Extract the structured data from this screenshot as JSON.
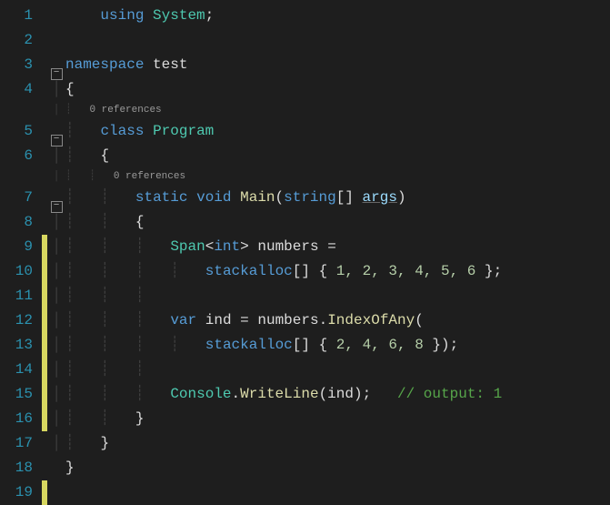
{
  "lines": [
    "1",
    "2",
    "3",
    "4",
    "5",
    "6",
    "7",
    "8",
    "9",
    "10",
    "11",
    "12",
    "13",
    "14",
    "15",
    "16",
    "17",
    "18",
    "19"
  ],
  "codelens1": "0 references",
  "codelens2": "0 references",
  "t": {
    "using": "using",
    "system": "System",
    "namespace": "namespace",
    "test": "test",
    "class": "class",
    "program": "Program",
    "static": "static",
    "void": "void",
    "main": "Main",
    "string": "string",
    "args": "args",
    "span": "Span",
    "int": "int",
    "numbers": "numbers",
    "stackalloc": "stackalloc",
    "nums1": "1, 2, 3, 4, 5, 6",
    "var": "var",
    "ind": "ind",
    "indexofany": "IndexOfAny",
    "nums2": "2, 4, 6, 8",
    "console": "Console",
    "writeline": "WriteLine",
    "comment": "// output: 1"
  }
}
